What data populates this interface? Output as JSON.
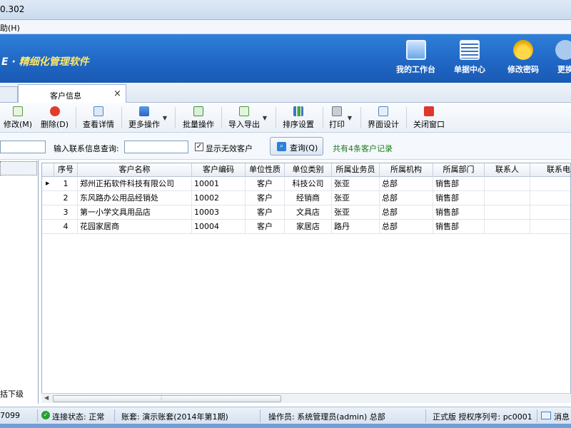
{
  "window": {
    "title": "0.302"
  },
  "menu": {
    "help": "助(H)"
  },
  "banner": {
    "brand_prefix": "E · ",
    "brand_title": "精细化管理软件",
    "nav": [
      {
        "label": "我的工作台",
        "icon": "monitor-icon"
      },
      {
        "label": "单据中心",
        "icon": "document-list-icon"
      },
      {
        "label": "修改密码",
        "icon": "lock-icon"
      },
      {
        "label": "更换",
        "icon": "user-switch-icon"
      }
    ]
  },
  "tabs": [
    {
      "label": "客户信息",
      "close": "×"
    }
  ],
  "toolbar": {
    "buttons": [
      {
        "label": "修改(M)",
        "icon": "edit-icon"
      },
      {
        "label": "删除(D)",
        "icon": "delete-icon"
      },
      {
        "label": "查看详情",
        "icon": "view-detail-icon"
      },
      {
        "label": "更多操作",
        "icon": "more-actions-icon",
        "arrow": "▼"
      },
      {
        "label": "批量操作",
        "icon": "batch-icon"
      },
      {
        "label": "导入导出",
        "icon": "import-export-icon",
        "arrow": "▼"
      },
      {
        "label": "排序设置",
        "icon": "sort-icon"
      },
      {
        "label": "打印",
        "icon": "print-icon",
        "arrow": "▼"
      },
      {
        "label": "界面设计",
        "icon": "layout-icon"
      },
      {
        "label": "关闭窗口",
        "icon": "close-window-icon"
      }
    ]
  },
  "filter": {
    "contact_label": "输入联系信息查询:",
    "contact_value": "",
    "show_invalid_label": "显示无效客户",
    "show_invalid_checked": "✓",
    "query_label": "查询(Q)",
    "query_icon": "search-icon",
    "count_text": "共有4条客户记录"
  },
  "left": {
    "footer": "括下级"
  },
  "grid": {
    "columns": [
      "序号",
      "客户名称",
      "客户编码",
      "单位性质",
      "单位类别",
      "所属业务员",
      "所属机构",
      "所属部门",
      "联系人",
      "联系电"
    ],
    "rows": [
      [
        "1",
        "郑州正拓软件科技有限公司",
        "10001",
        "客户",
        "科技公司",
        "张亚",
        "总部",
        "销售部",
        "",
        ""
      ],
      [
        "2",
        "东风路办公用品经销处",
        "10002",
        "客户",
        "经销商",
        "张亚",
        "总部",
        "销售部",
        "",
        ""
      ],
      [
        "3",
        "第一小学文具用品店",
        "10003",
        "客户",
        "文具店",
        "张亚",
        "总部",
        "销售部",
        "",
        ""
      ],
      [
        "4",
        "花园家居商",
        "10004",
        "客户",
        "家居店",
        "路丹",
        "总部",
        "销售部",
        "",
        ""
      ]
    ],
    "current_row_marker": "▶"
  },
  "scroll": {
    "left_arrow": "◀",
    "grip": "⦙"
  },
  "status": {
    "version_code": "7099",
    "connection": "连接状态: 正常",
    "account": "账套: 演示账套(2014年第1期)",
    "operator": "操作员: 系统管理员(admin) 总部",
    "license": "正式版 授权序列号: pc0001",
    "message": "消息",
    "ok_icon": "✓"
  },
  "colors": {
    "banner": "#1f66c4",
    "brand_title": "#ffe86a",
    "count_text": "#1a7a1a",
    "status_ok": "#27a12f"
  }
}
